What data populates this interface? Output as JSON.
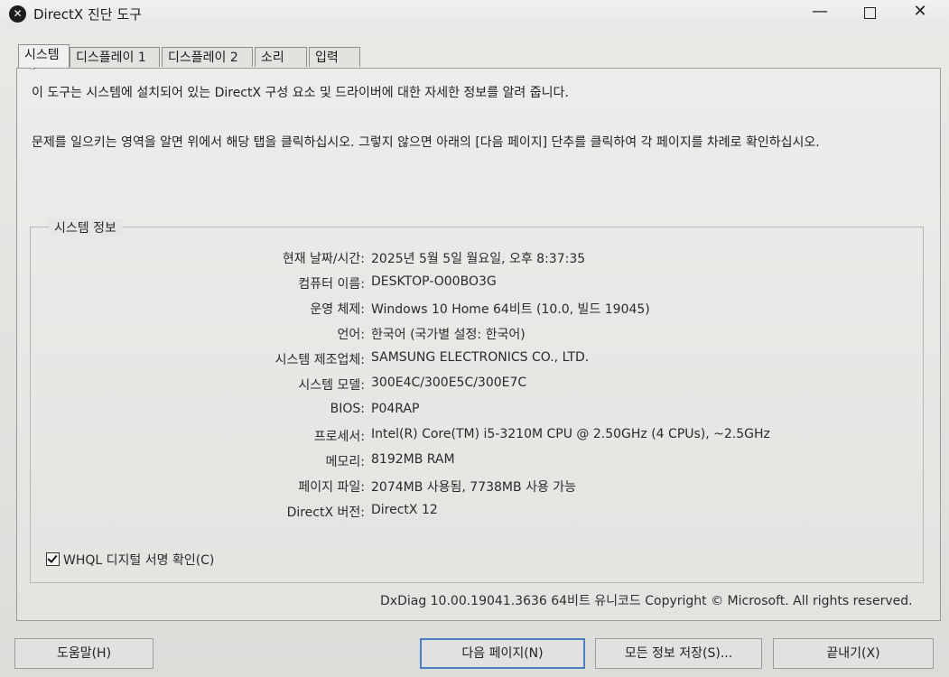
{
  "window": {
    "title": "DirectX 진단 도구",
    "minimize": "—",
    "close": "✕"
  },
  "tabs": [
    {
      "label": "시스템",
      "active": true
    },
    {
      "label": "디스플레이 1"
    },
    {
      "label": "디스플레이 2"
    },
    {
      "label": "소리"
    },
    {
      "label": "입력"
    }
  ],
  "intro": {
    "line1": "이 도구는 시스템에 설치되어 있는 DirectX 구성 요소 및 드라이버에 대한 자세한 정보를 알려 줍니다.",
    "line2": "문제를 일으키는 영역을 알면 위에서 해당 탭을 클릭하십시오. 그렇지 않으면 아래의 [다음 페이지] 단추를 클릭하여 각 페이지를 차례로 확인하십시오."
  },
  "system_info": {
    "group_title": "시스템 정보",
    "rows": [
      {
        "label": "현재 날짜/시간:",
        "value": "2025년 5월 5일 월요일, 오후 8:37:35"
      },
      {
        "label": "컴퓨터 이름:",
        "value": "DESKTOP-O00BO3G"
      },
      {
        "label": "운영 체제:",
        "value": "Windows 10 Home 64비트 (10.0, 빌드 19045)"
      },
      {
        "label": "언어:",
        "value": "한국어 (국가별 설정: 한국어)"
      },
      {
        "label": "시스템 제조업체:",
        "value": "SAMSUNG ELECTRONICS CO., LTD."
      },
      {
        "label": "시스템 모델:",
        "value": "300E4C/300E5C/300E7C"
      },
      {
        "label": "BIOS:",
        "value": "P04RAP"
      },
      {
        "label": "프로세서:",
        "value": "Intel(R) Core(TM) i5-3210M CPU @ 2.50GHz (4 CPUs), ~2.5GHz"
      },
      {
        "label": "메모리:",
        "value": "8192MB RAM"
      },
      {
        "label": "페이지 파일:",
        "value": "2074MB 사용됨, 7738MB 사용 가능"
      },
      {
        "label": "DirectX 버전:",
        "value": "DirectX 12"
      }
    ]
  },
  "whql": {
    "label": "WHQL 디지털 서명 확인(C)",
    "checked": true
  },
  "footer": "DxDiag 10.00.19041.3636 64비트 유니코드  Copyright © Microsoft. All rights reserved.",
  "buttons": {
    "help": "도움말(H)",
    "next": "다음 페이지(N)",
    "save": "모든 정보 저장(S)...",
    "exit": "끝내기(X)"
  }
}
